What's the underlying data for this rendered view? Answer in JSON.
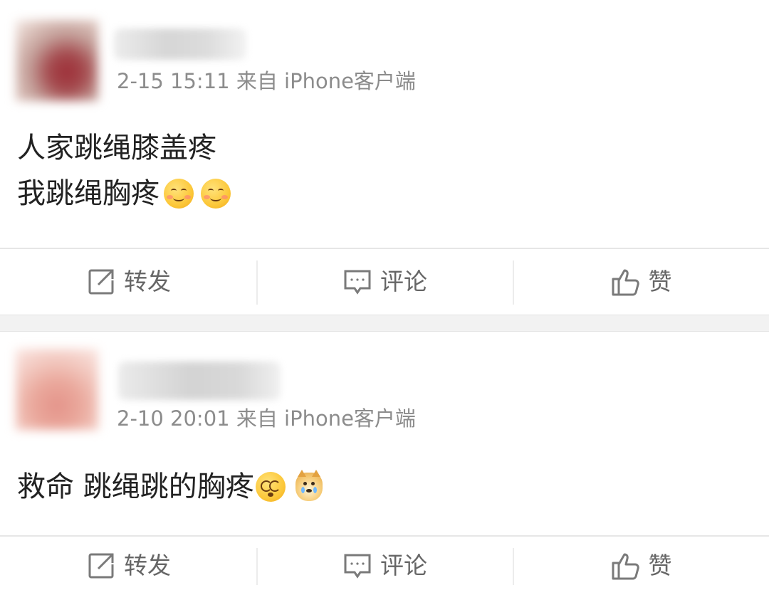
{
  "posts": [
    {
      "meta": "2-15 15:11 来自 iPhone客户端",
      "content_lines": [
        "人家跳绳膝盖疼",
        "我跳绳胸疼"
      ],
      "emojis": [
        "smiling-blush-emoji",
        "smiling-blush-emoji"
      ],
      "actions": {
        "repost": {
          "label": "转发",
          "icon": "repost-icon"
        },
        "comment": {
          "label": "评论",
          "icon": "comment-icon"
        },
        "like": {
          "label": "赞",
          "icon": "thumbs-up-icon"
        }
      }
    },
    {
      "meta": "2-10 20:01 来自 iPhone客户端",
      "content_lines": [
        "救命 跳绳跳的胸疼"
      ],
      "emojis": [
        "dizzy-face-emoji",
        "crying-doge-emoji"
      ],
      "actions": {
        "repost": {
          "label": "转发",
          "icon": "repost-icon"
        },
        "comment": {
          "label": "评论",
          "icon": "comment-icon"
        },
        "like": {
          "label": "赞",
          "icon": "thumbs-up-icon"
        }
      }
    }
  ],
  "colors": {
    "meta_text": "#8c8c8c",
    "content_text": "#222222",
    "action_text": "#666666",
    "separator": "#f2f2f2"
  }
}
